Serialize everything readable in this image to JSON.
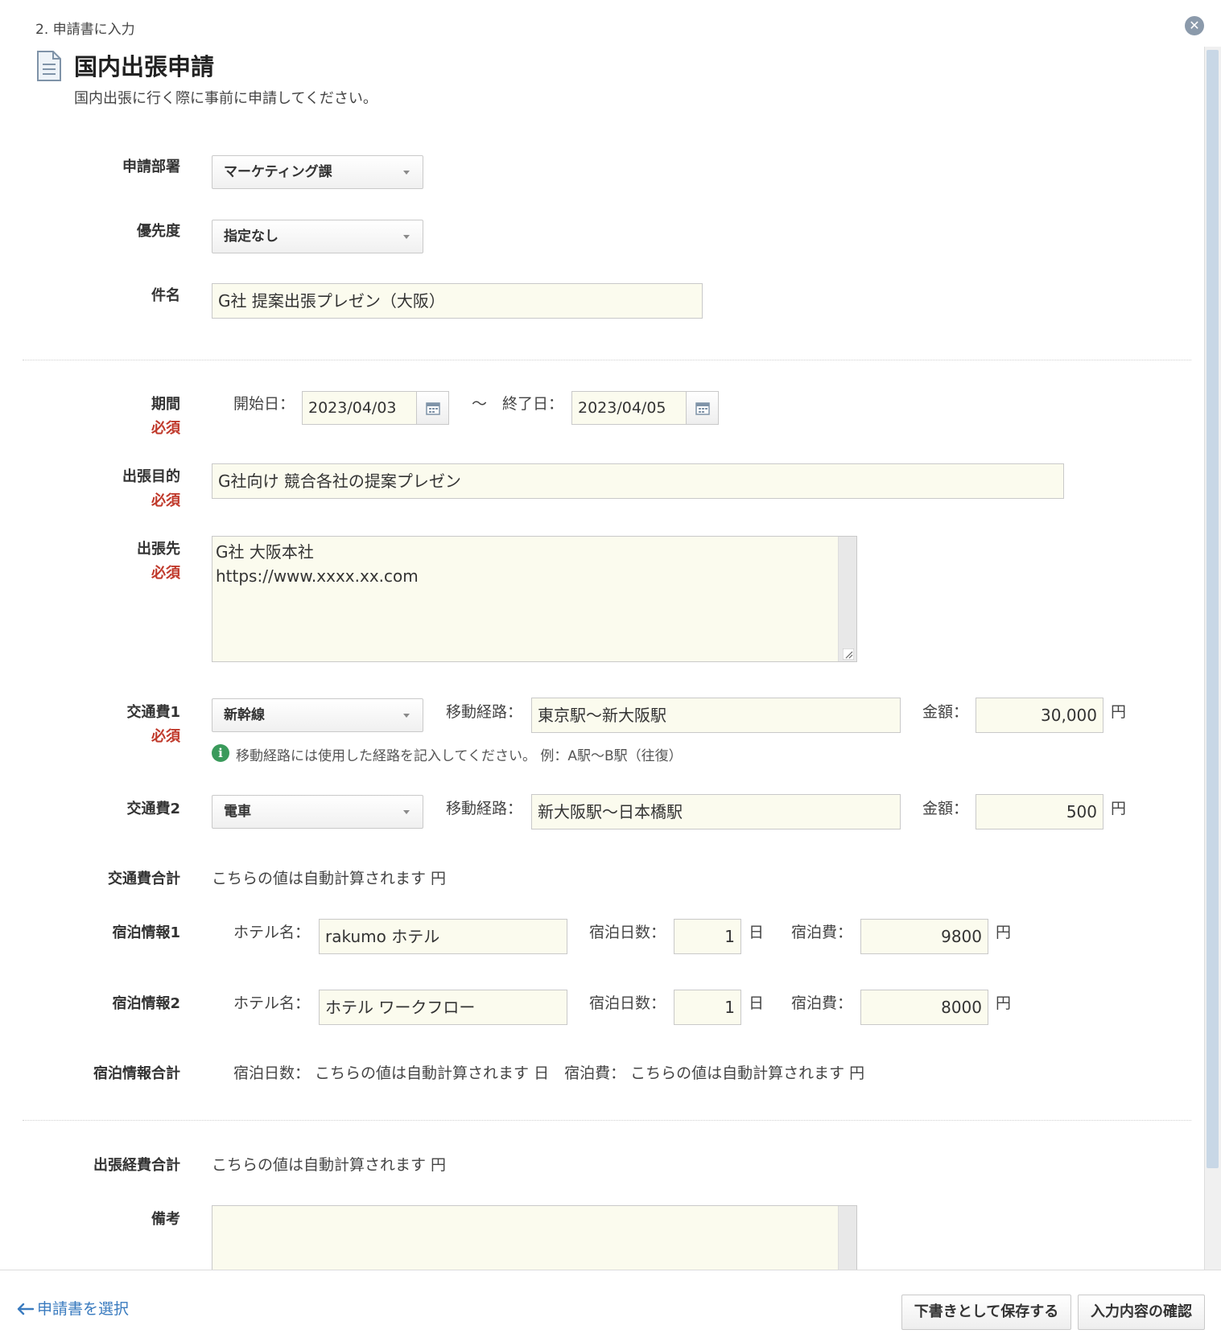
{
  "header": {
    "step": "2. 申請書に入力",
    "title": "国内出張申請",
    "description": "国内出張に行く際に事前に申請してください。"
  },
  "required_label": "必須",
  "fields": {
    "department": {
      "label": "申請部署",
      "value": "マーケティング課"
    },
    "priority": {
      "label": "優先度",
      "value": "指定なし"
    },
    "subject": {
      "label": "件名",
      "value": "G社 提案出張プレゼン（大阪）"
    },
    "period": {
      "label": "期間",
      "start_label": "開始日：",
      "start_value": "2023/04/03",
      "separator": "～",
      "end_label": "終了日：",
      "end_value": "2023/04/05"
    },
    "purpose": {
      "label": "出張目的",
      "value": "G社向け 競合各社の提案プレゼン"
    },
    "destination": {
      "label": "出張先",
      "value": "G社 大阪本社\nhttps://www.xxxx.xx.com"
    },
    "transport1": {
      "label": "交通費1",
      "type": "新幹線",
      "route_label": "移動経路：",
      "route": "東京駅～新大阪駅",
      "amount_label": "金額：",
      "amount": "30,000",
      "unit": "円",
      "note": "移動経路には使用した経路を記入してください。 例：A駅～B駅（往復）"
    },
    "transport2": {
      "label": "交通費2",
      "type": "電車",
      "route_label": "移動経路：",
      "route": "新大阪駅～日本橋駅",
      "amount_label": "金額：",
      "amount": "500",
      "unit": "円"
    },
    "transport_total": {
      "label": "交通費合計",
      "value": "こちらの値は自動計算されます 円"
    },
    "lodging1": {
      "label": "宿泊情報1",
      "hotel_label": "ホテル名：",
      "hotel": "rakumo ホテル",
      "nights_label": "宿泊日数：",
      "nights": "1",
      "nights_unit": "日",
      "cost_label": "宿泊費：",
      "cost": "9800",
      "cost_unit": "円"
    },
    "lodging2": {
      "label": "宿泊情報2",
      "hotel_label": "ホテル名：",
      "hotel": "ホテル ワークフロー",
      "nights_label": "宿泊日数：",
      "nights": "1",
      "nights_unit": "日",
      "cost_label": "宿泊費：",
      "cost": "8000",
      "cost_unit": "円"
    },
    "lodging_total": {
      "label": "宿泊情報合計",
      "value": "宿泊日数： こちらの値は自動計算されます 日　宿泊費： こちらの値は自動計算されます 円"
    },
    "expense_total": {
      "label": "出張経費合計",
      "value": "こちらの値は自動計算されます 円"
    },
    "remarks": {
      "label": "備考",
      "value": ""
    }
  },
  "footer": {
    "back_link": "申請書を選択",
    "save_draft": "下書きとして保存する",
    "confirm": "入力内容の確認"
  },
  "colors": {
    "input_bg": "#fbfbee",
    "required": "#c0392b",
    "link": "#3a7bbf",
    "info": "#3a9a5b"
  }
}
